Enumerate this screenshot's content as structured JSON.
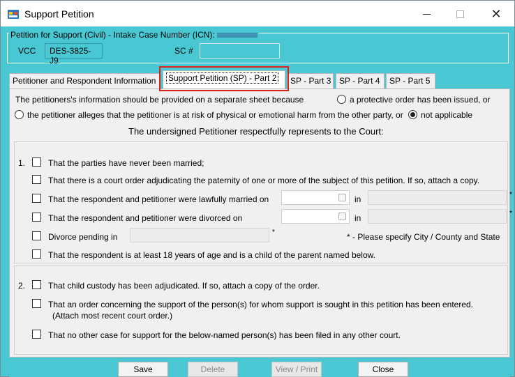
{
  "window": {
    "title": "Support Petition",
    "icon": "form-window-icon",
    "controls": [
      "minimize-icon",
      "maximize-icon",
      "close-icon"
    ]
  },
  "header": {
    "group_label": "Petition for Support (Civil) - Intake Case Number (ICN):",
    "vcc_label": "VCC",
    "vcc_value": "DES-3825-J9",
    "sc_label": "SC #",
    "sc_value": ""
  },
  "tabs": [
    {
      "label": "Petitioner and Respondent Information",
      "active": false
    },
    {
      "label": "Support Petition (SP) - Part 2",
      "active": true
    },
    {
      "label": "SP - Part 3",
      "active": false
    },
    {
      "label": "SP - Part 4",
      "active": false
    },
    {
      "label": "SP - Part 5",
      "active": false
    }
  ],
  "intro": {
    "line1": "The petitioners's information should be provided on a separate sheet because",
    "opt_protective": "a protective order has been issued,  or",
    "opt_risk": "the petitioner alleges that the petitioner is at risk of physical or emotional harm from the other party,  or",
    "opt_na": "not applicable",
    "selected": "not applicable",
    "heading": "The undersigned Petitioner respectfully represents to the Court:"
  },
  "section1": {
    "number": "1.",
    "never_married": "That the parties have never been married;",
    "court_order": "That there is a court order adjudicating the paternity of one or more of the subject of this petition. If so, attach a copy.",
    "married_on": "That the respondent and petitioner were lawfully married on",
    "divorced_on": "That the respondent and petitioner were divorced on",
    "divorce_pending": "Divorce pending in",
    "in_label": "in",
    "asterisk": "*",
    "note": "* - Please specify City / County and State",
    "age18": "That the respondent is at least 18 years of age and is a child of the parent named below."
  },
  "section2": {
    "number": "2.",
    "custody": "That child custody has been adjudicated. If so, attach a copy of the order.",
    "order_entered": "That an order concerning the support of the person(s) for whom support is sought in this petition has been entered.",
    "order_note": "(Attach most recent court order.)",
    "no_other_case": "That no other case for support for the below-named person(s) has been filed in any other court."
  },
  "buttons": {
    "save": "Save",
    "delete": "Delete",
    "view_print": "View / Print",
    "close": "Close"
  }
}
